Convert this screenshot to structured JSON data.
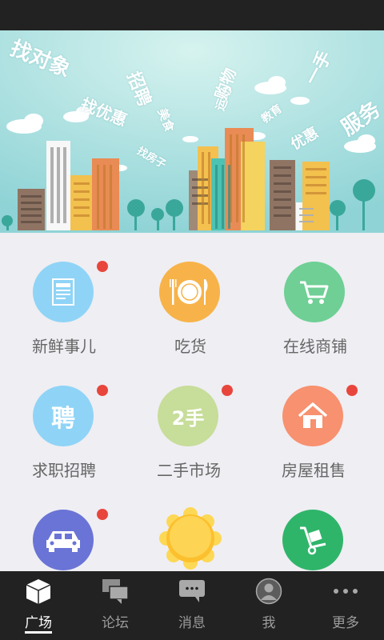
{
  "banner": {
    "words": [
      "找对象",
      "找优惠",
      "招聘",
      "美食",
      "找房子",
      "运动",
      "购物",
      "教育",
      "优惠",
      "一手",
      "服务"
    ]
  },
  "grid": {
    "items": [
      {
        "label": "新鲜事儿",
        "icon": "newspaper-icon",
        "color": "#8fd4f6",
        "badge": true
      },
      {
        "label": "吃货",
        "icon": "plate-cutlery-icon",
        "color": "#f7b349",
        "badge": false
      },
      {
        "label": "在线商铺",
        "icon": "shopping-cart-icon",
        "color": "#6fcf95",
        "badge": false
      },
      {
        "label": "求职招聘",
        "icon": "pin-recruit-icon",
        "color": "#8fd4f6",
        "glyph": "聘",
        "badge": true
      },
      {
        "label": "二手市场",
        "icon": "second-hand-icon",
        "color": "#c7dd9a",
        "glyph": "2手",
        "badge": true
      },
      {
        "label": "房屋租售",
        "icon": "house-icon",
        "color": "#f7916f",
        "badge": true
      },
      {
        "label": "",
        "icon": "car-icon",
        "color": "#6a74d6",
        "badge": true
      },
      {
        "label": "",
        "icon": "sun-icon",
        "color": "#fbc93a",
        "badge": false
      },
      {
        "label": "",
        "icon": "hand-truck-icon",
        "color": "#2fb56a",
        "badge": false
      }
    ]
  },
  "tabbar": {
    "tabs": [
      {
        "label": "广场",
        "icon": "cube-icon",
        "active": true
      },
      {
        "label": "论坛",
        "icon": "chat-bubbles-icon",
        "active": false
      },
      {
        "label": "消息",
        "icon": "message-icon",
        "active": false
      },
      {
        "label": "我",
        "icon": "user-avatar-icon",
        "active": false
      },
      {
        "label": "更多",
        "icon": "more-dots-icon",
        "active": false
      }
    ]
  },
  "colors": {
    "accent_badge": "#e8463c",
    "bar_bg": "#222222",
    "page_bg": "#efeef3"
  }
}
